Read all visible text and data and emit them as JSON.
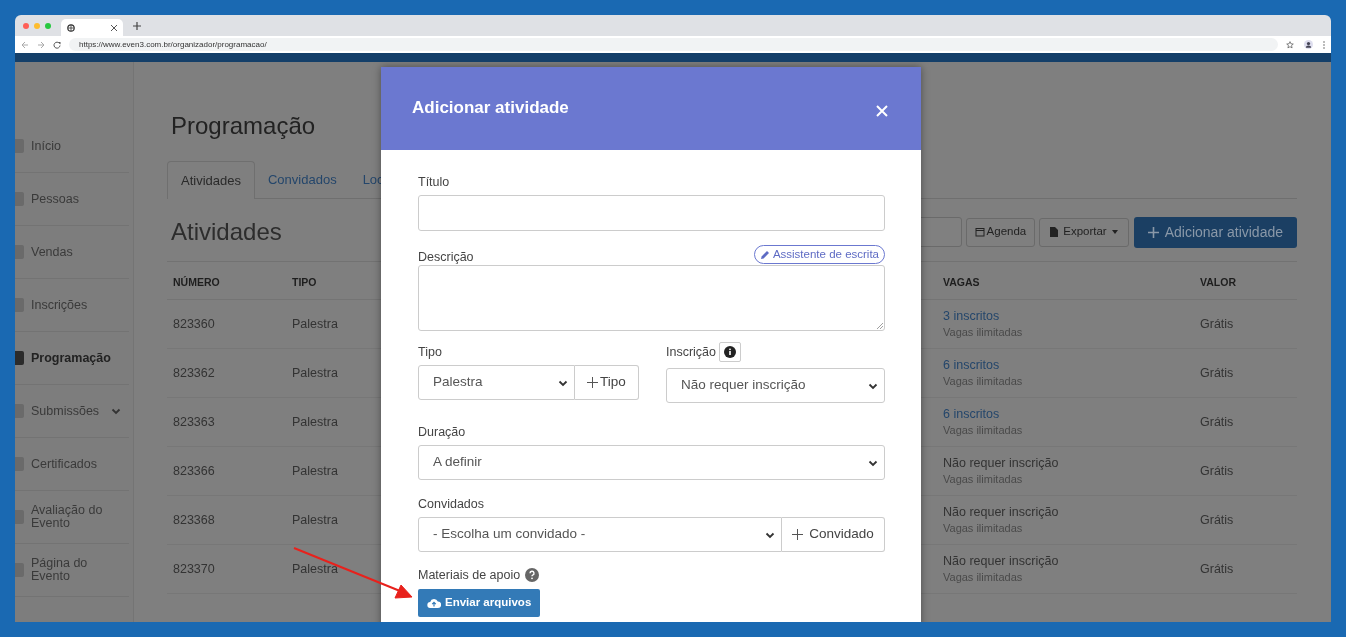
{
  "browser": {
    "url": "https://www.even3.com.br/organizador/programacao/"
  },
  "sidebar": {
    "items": [
      {
        "label": "Início",
        "kind": "link",
        "selected": false
      },
      {
        "label": "Pessoas",
        "kind": "link",
        "selected": false
      },
      {
        "label": "Vendas",
        "kind": "link",
        "selected": false
      },
      {
        "label": "Inscrições",
        "kind": "link",
        "selected": false
      },
      {
        "label": "Programação",
        "kind": "link",
        "selected": true
      },
      {
        "label": "Submissões",
        "kind": "expandable",
        "selected": false
      },
      {
        "label": "Certificados",
        "kind": "link",
        "selected": false
      },
      {
        "label": "Avaliação do Evento",
        "kind": "link",
        "selected": false
      },
      {
        "label": "Página do Evento",
        "kind": "link",
        "selected": false
      }
    ]
  },
  "page": {
    "title": "Programação",
    "tabs": [
      {
        "label": "Atividades",
        "selected": true
      },
      {
        "label": "Convidados",
        "selected": false
      },
      {
        "label": "Loc",
        "selected": false
      }
    ],
    "section_title": "Atividades",
    "toolbar": {
      "agenda": "Agenda",
      "export": "Exportar",
      "add": "Adicionar atividade"
    },
    "table": {
      "columns": [
        "NÚMERO",
        "TIPO",
        "VAGAS",
        "VALOR"
      ],
      "rows": [
        {
          "number": "823360",
          "type": "Palestra",
          "vagas": "3 inscritos",
          "vagas_link": true,
          "vagas_note": "Vagas ilimitadas",
          "valor": "Grátis"
        },
        {
          "number": "823362",
          "type": "Palestra",
          "vagas": "6 inscritos",
          "vagas_link": true,
          "vagas_note": "Vagas ilimitadas",
          "valor": "Grátis"
        },
        {
          "number": "823363",
          "type": "Palestra",
          "vagas": "6 inscritos",
          "vagas_link": true,
          "vagas_note": "Vagas ilimitadas",
          "valor": "Grátis"
        },
        {
          "number": "823366",
          "type": "Palestra",
          "vagas": "Não requer inscrição",
          "vagas_link": false,
          "vagas_note": "Vagas ilimitadas",
          "valor": "Grátis"
        },
        {
          "number": "823368",
          "type": "Palestra",
          "vagas": "Não requer inscrição",
          "vagas_link": false,
          "vagas_note": "Vagas ilimitadas",
          "valor": "Grátis"
        },
        {
          "number": "823370",
          "type": "Palestra",
          "vagas": "Não requer inscrição",
          "vagas_link": false,
          "vagas_note": "Vagas ilimitadas",
          "valor": "Grátis"
        }
      ]
    }
  },
  "modal": {
    "title": "Adicionar atividade",
    "titulo_label": "Título",
    "descricao_label": "Descrição",
    "assistant": "Assistente de escrita",
    "tipo_label": "Tipo",
    "tipo_value": "Palestra",
    "tipo_add": "Tipo",
    "inscricao_label": "Inscrição",
    "inscricao_value": "Não requer inscrição",
    "duracao_label": "Duração",
    "duracao_value": "A definir",
    "convidados_label": "Convidados",
    "convidados_value": "- Escolha um convidado -",
    "convidados_add": "Convidado",
    "materiais_label": "Materiais de apoio",
    "upload": "Enviar arquivos"
  }
}
